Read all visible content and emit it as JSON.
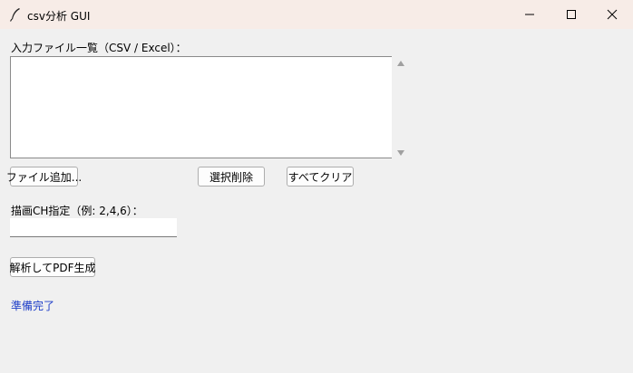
{
  "window": {
    "title": "csv分析 GUI",
    "icon": "feather-icon"
  },
  "files": {
    "label": "入力ファイル一覧（CSV / Excel）：",
    "items": []
  },
  "buttons": {
    "add_file": "ファイル追加...",
    "delete_selected": "選択削除",
    "clear_all": "すべてクリア",
    "generate_pdf": "解析してPDF生成"
  },
  "channels": {
    "label": "描画CH指定（例: 2,4,6）：",
    "value": ""
  },
  "status": {
    "text": "準備完了",
    "color": "#1e3ec8"
  },
  "colors": {
    "titlebar": "#f7ece7",
    "background": "#f0f0f0"
  }
}
